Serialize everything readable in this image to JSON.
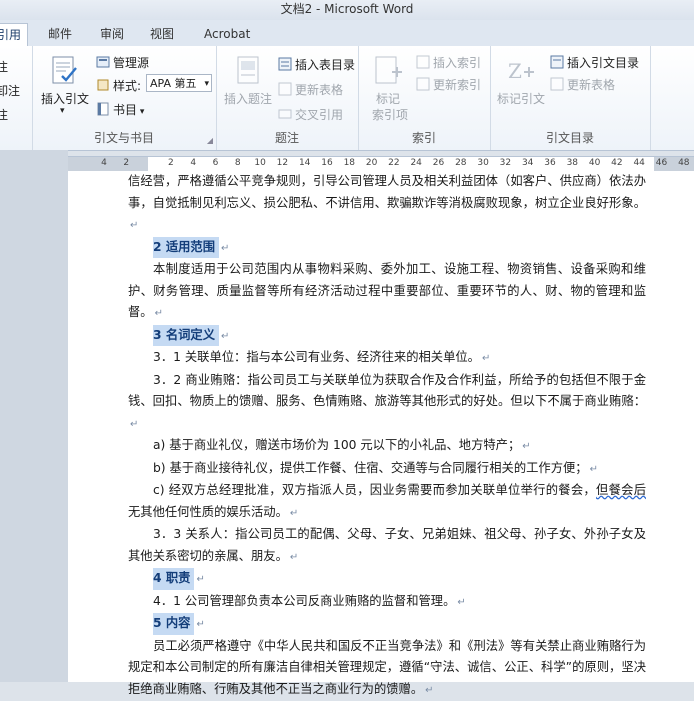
{
  "window": {
    "title": "文档2 - Microsoft Word"
  },
  "tabs": [
    {
      "label": "引用",
      "active": true
    },
    {
      "label": "邮件"
    },
    {
      "label": "审阅"
    },
    {
      "label": "视图"
    },
    {
      "label": "Acrobat"
    }
  ],
  "ribbon": {
    "left_partial": [
      "注",
      "卸注",
      "注"
    ],
    "group_citations": {
      "label": "引文与书目",
      "insert_citation": "插入引文",
      "manage_sources": "管理源",
      "style_label": "样式:",
      "style_value": "APA 第五",
      "bibliography": "书目"
    },
    "group_captions": {
      "label": "题注",
      "insert_caption": "插入题注",
      "insert_table_of_figures": "插入表目录",
      "update_table": "更新表格",
      "cross_reference": "交叉引用"
    },
    "group_index": {
      "label": "索引",
      "mark_entry": "标记\n索引项",
      "insert_index": "插入索引",
      "update_index": "更新索引"
    },
    "group_authorities": {
      "label": "引文目录",
      "mark_citation": "标记引文",
      "insert_table_of_authorities": "插入引文目录",
      "update_table": "更新表格"
    }
  },
  "ruler": {
    "ticks": [
      "4",
      "2",
      "",
      "2",
      "4",
      "6",
      "8",
      "10",
      "12",
      "14",
      "16",
      "18",
      "20",
      "22",
      "24",
      "26",
      "28",
      "30",
      "32",
      "34",
      "36",
      "38",
      "40",
      "42",
      "44",
      "46",
      "48",
      "50"
    ]
  },
  "document": {
    "para_intro": "信经营，严格遵循公平竞争规则，引导公司管理人员及相关利益团体（如客户、供应商）依法办事，自觉抵制见利忘义、损公肥私、不讲信用、欺骗欺诈等消极腐败现象，树立企业良好形象。",
    "h2": "2 适用范围",
    "para_scope": "本制度适用于公司范围内从事物料采购、委外加工、设施工程、物资销售、设备采购和维护、财务管理、质量监督等所有经济活动过程中重要部位、重要环节的人、财、物的管理和监督。",
    "h3": "3 名词定义",
    "def_3_1": "3．1 关联单位：指与本公司有业务、经济往来的相关单位。",
    "def_3_2": "3．2 商业贿赂：指公司员工与关联单位为获取合作及合作利益，所给予的包括但不限于金钱、回扣、物质上的馈赠、服务、色情贿赂、旅游等其他形式的好处。但以下不属于商业贿赂：",
    "item_a": "a) 基于商业礼仪，赠送市场价为 100 元以下的小礼品、地方特产；",
    "item_b": "b) 基于商业接待礼仪，提供工作餐、住宿、交通等与合同履行相关的工作方便；",
    "item_c_1": "c) 经双方总经理批准，双方指派人员，因业务需要而参加关联单位举行的餐会，",
    "item_c_sq": "但餐会后",
    "item_c_2": "无其他任何性质的娱乐活动。",
    "def_3_3": "3．3 关系人：指公司员工的配偶、父母、子女、兄弟姐妹、祖父母、孙子女、外孙子女及其他关系密切的亲属、朋友。",
    "h4": "4 职责",
    "duty_4_1": "4．1 公司管理部负责本公司反商业贿赂的监督和管理。",
    "h5": "5 内容",
    "para_content": "员工必须严格遵守《中华人民共和国反不正当竞争法》和《刑法》等有关禁止商业贿赂行为规定和本公司制定的所有廉洁自律相关管理规定，遵循“守法、诚信、公正、科学”的原则，坚决拒绝商业贿赂、行贿及其他不正当之商业行为的馈赠。",
    "para_mark": "↵"
  }
}
